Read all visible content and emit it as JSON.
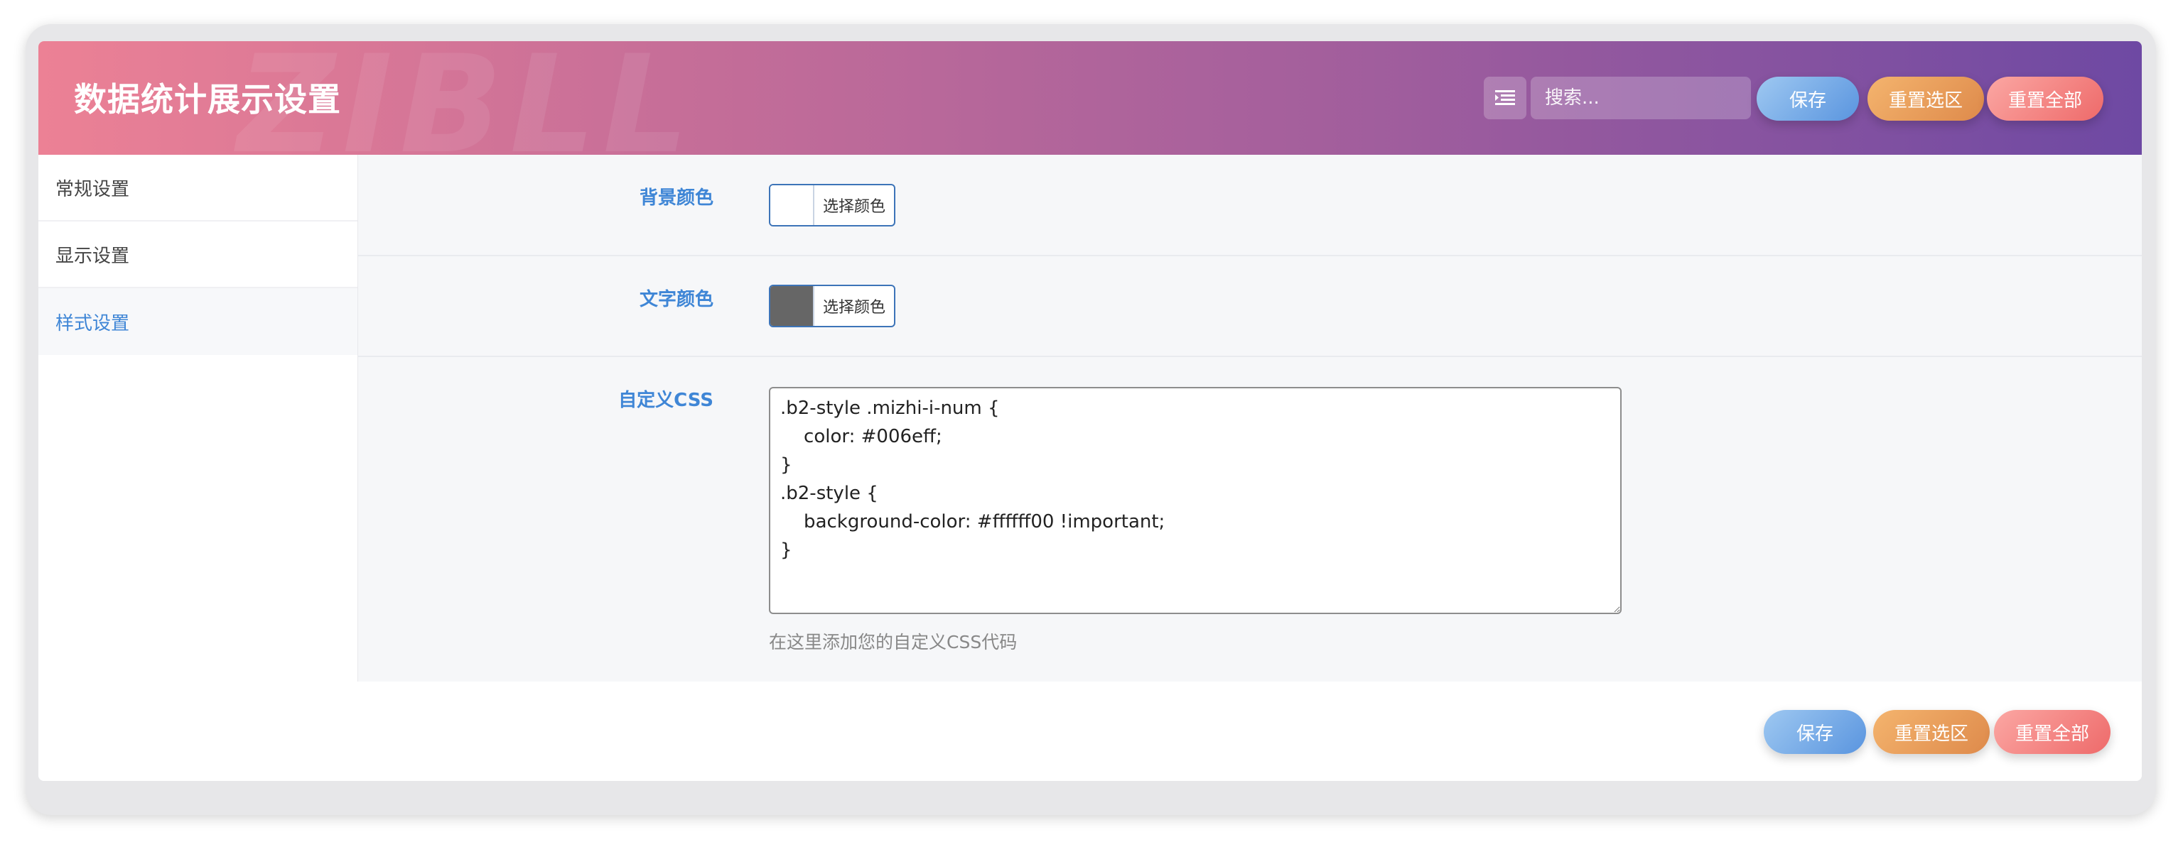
{
  "header": {
    "title": "数据统计展示设置",
    "watermark": "ZIBLL",
    "search_placeholder": "搜索...",
    "save_label": "保存",
    "reset_section_label": "重置选区",
    "reset_all_label": "重置全部"
  },
  "sidebar": {
    "items": [
      {
        "label": "常规设置"
      },
      {
        "label": "显示设置"
      },
      {
        "label": "样式设置"
      }
    ]
  },
  "fields": {
    "bg_color": {
      "label": "背景颜色",
      "button": "选择颜色",
      "swatch": "#ffffff"
    },
    "text_color": {
      "label": "文字颜色",
      "button": "选择颜色",
      "swatch": "#666666"
    },
    "custom_css": {
      "label": "自定义CSS",
      "value": ".b2-style .mizhi-i-num {\n    color: #006eff;\n}\n.b2-style {\n    background-color: #ffffff00 !important;\n}",
      "hint": "在这里添加您的自定义CSS代码"
    }
  },
  "footer": {
    "save_label": "保存",
    "reset_section_label": "重置选区",
    "reset_all_label": "重置全部"
  },
  "colors": {
    "accent": "#3f86d6",
    "header_gradient_start": "#ec8195",
    "header_gradient_end": "#6e49a3"
  }
}
